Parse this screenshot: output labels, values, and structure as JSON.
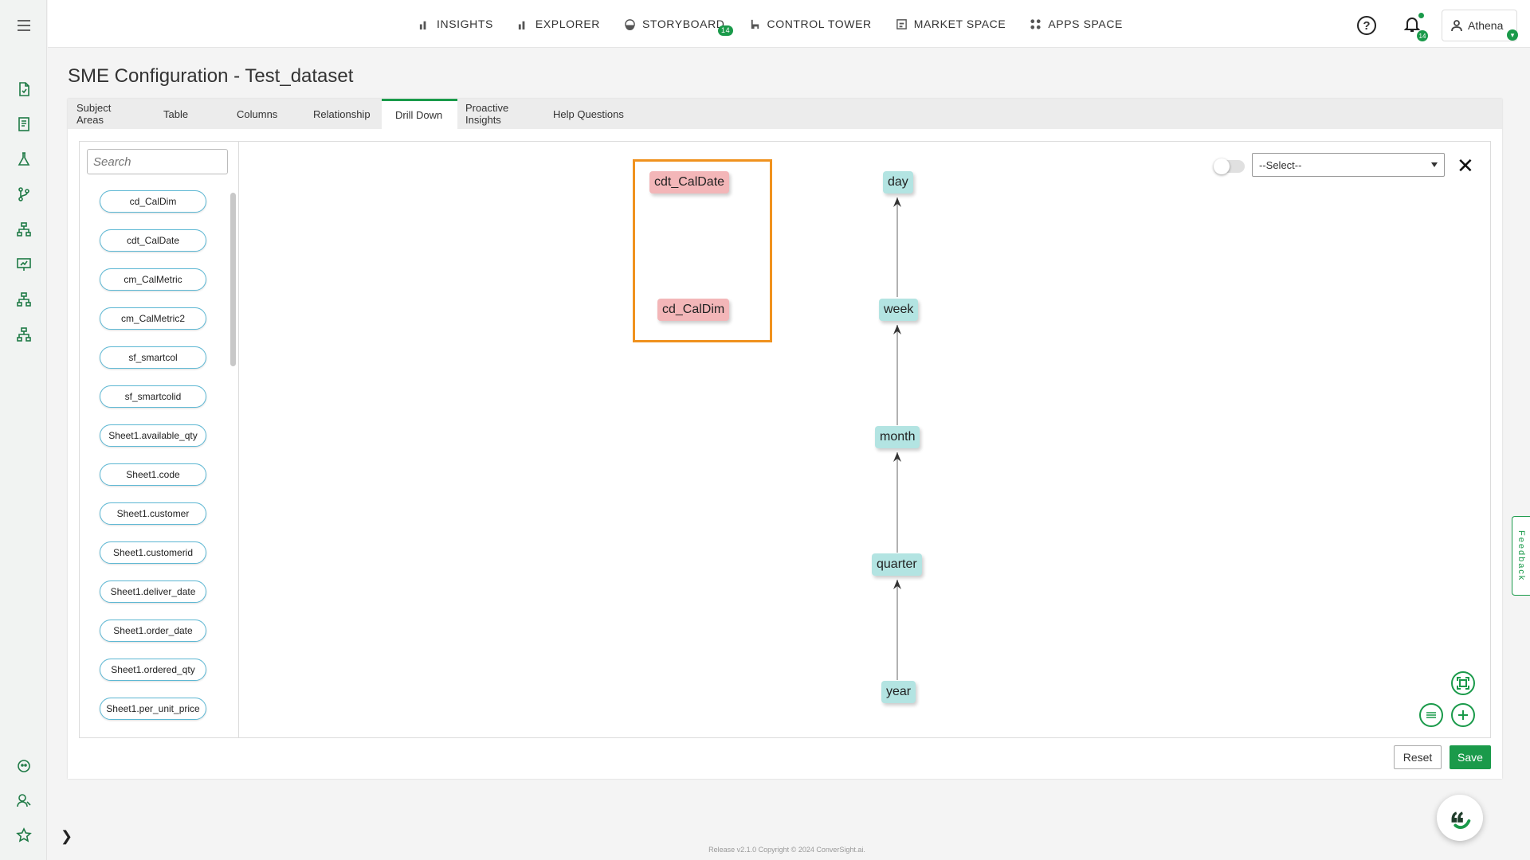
{
  "nav": {
    "items": [
      {
        "label": "INSIGHTS",
        "icon": "bar-chart-icon"
      },
      {
        "label": "EXPLORER",
        "icon": "bar-chart-icon"
      },
      {
        "label": "STORYBOARD",
        "icon": "storyboard-icon",
        "badge": "14"
      },
      {
        "label": "CONTROL TOWER",
        "icon": "tower-icon"
      },
      {
        "label": "MARKET SPACE",
        "icon": "market-icon"
      },
      {
        "label": "APPS SPACE",
        "icon": "apps-icon"
      }
    ],
    "notification_count": "14",
    "user_name": "Athena"
  },
  "page": {
    "title": "SME Configuration - Test_dataset",
    "tabs": [
      "Subject Areas",
      "Table",
      "Columns",
      "Relationship",
      "Drill Down",
      "Proactive Insights",
      "Help Questions"
    ],
    "active_tab": "Drill Down"
  },
  "sidebar": {
    "search_placeholder": "Search",
    "columns": [
      "cd_CalDim",
      "cdt_CalDate",
      "cm_CalMetric",
      "cm_CalMetric2",
      "sf_smartcol",
      "sf_smartcolid",
      "Sheet1.available_qty",
      "Sheet1.code",
      "Sheet1.customer",
      "Sheet1.customerid",
      "Sheet1.deliver_date",
      "Sheet1.order_date",
      "Sheet1.ordered_qty",
      "Sheet1.per_unit_price"
    ]
  },
  "canvas": {
    "unassigned_nodes": [
      "cdt_CalDate",
      "cd_CalDim"
    ],
    "hierarchy": [
      "day",
      "week",
      "month",
      "quarter",
      "year"
    ],
    "select_placeholder": "--Select--"
  },
  "actions": {
    "reset": "Reset",
    "save": "Save"
  },
  "feedback_label": "Feedback",
  "footer": "Release v2.1.0 Copyright © 2024 ConverSight.ai.",
  "colors": {
    "accent": "#1a9a4a",
    "highlight": "#f0921e",
    "node_pink": "#f3b6b8",
    "node_teal": "#b3e4e2"
  }
}
